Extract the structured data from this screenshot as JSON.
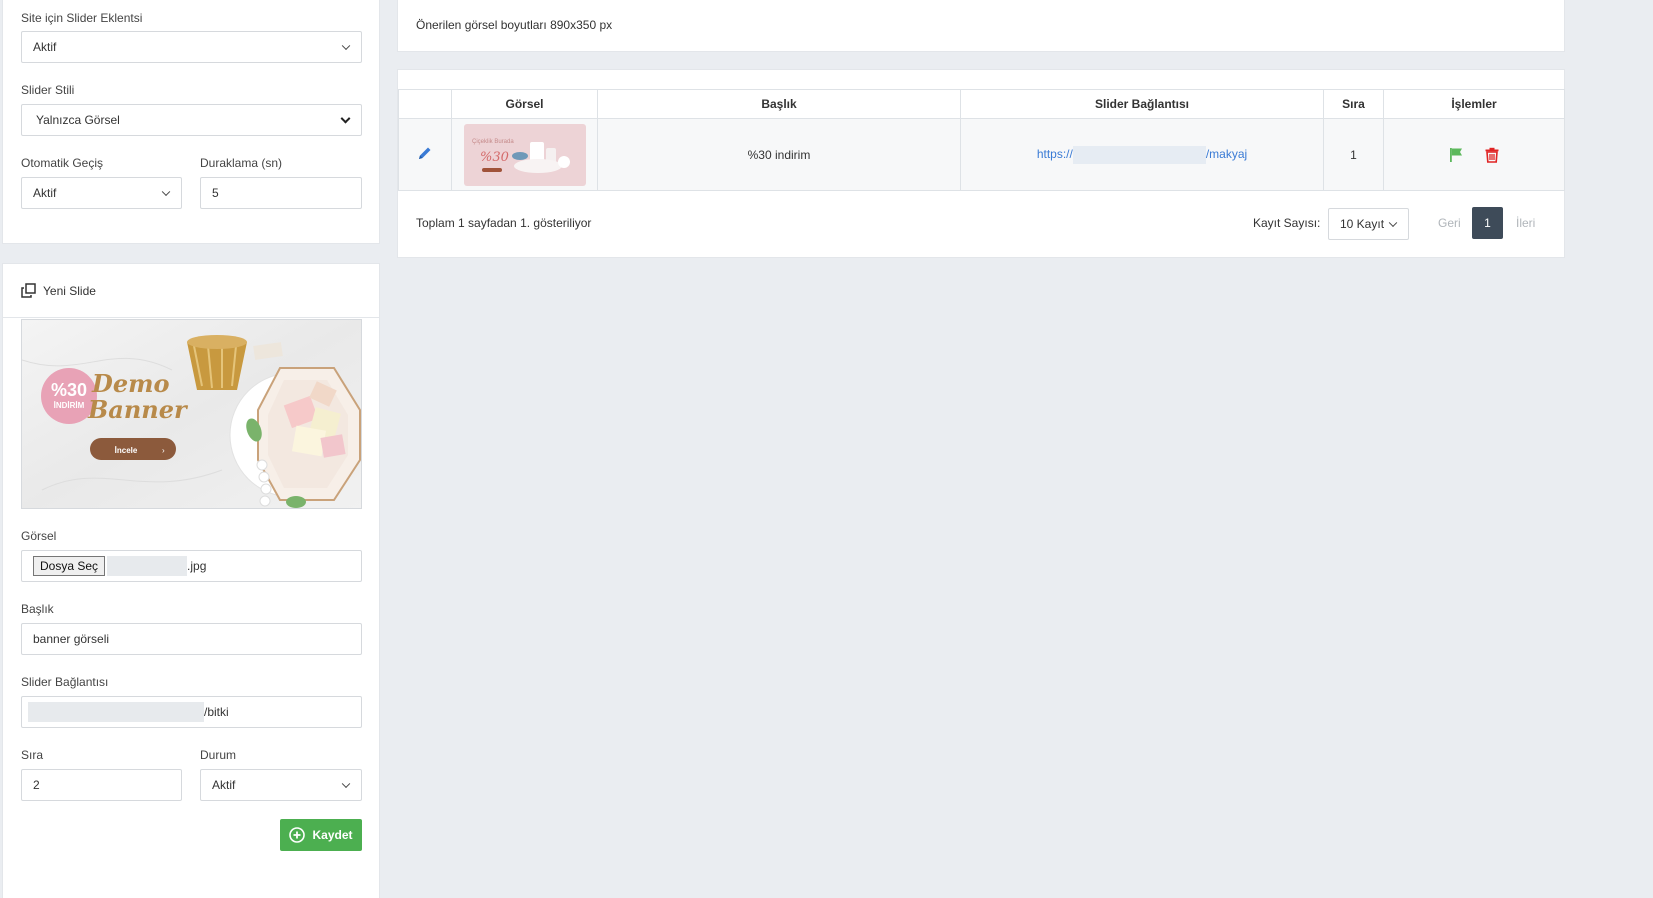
{
  "settings": {
    "plugin_label": "Site için Slider Eklentsi",
    "plugin_value": "Aktif",
    "style_label": "Slider Stili",
    "style_value": "Yalnızca Görsel",
    "auto_label": "Otomatik Geçiş",
    "auto_value": "Aktif",
    "pause_label": "Duraklama (sn)",
    "pause_value": "5"
  },
  "new_slide": {
    "title": "Yeni Slide",
    "preview": {
      "discount": "%30",
      "discount_sub": "İNDİRİM",
      "line1": "Demo",
      "line2": "Banner",
      "button": "İncele"
    },
    "image_label": "Görsel",
    "file_button": "Dosya Seç",
    "file_suffix": ".jpg",
    "title_label": "Başlık",
    "title_value": "banner görseli",
    "link_label": "Slider Bağlantısı",
    "link_suffix": "/bitki",
    "order_label": "Sıra",
    "order_value": "2",
    "status_label": "Durum",
    "status_value": "Aktif",
    "save_label": "Kaydet"
  },
  "info": {
    "text": "Önerilen görsel boyutları 890x350 px"
  },
  "table": {
    "headers": [
      "",
      "Görsel",
      "Başlık",
      "Slider Bağlantısı",
      "Sıra",
      "İşlemler"
    ],
    "rows": [
      {
        "thumb_text": "Çiçeklik Burada",
        "thumb_discount": "%30",
        "title": "%30 indirim",
        "link_prefix": "https://",
        "link_suffix": "/makyaj",
        "order": "1"
      }
    ],
    "footer": "Toplam 1 sayfadan 1. gösteriliyor",
    "page_size_label": "Kayıt Sayısı:",
    "page_size_value": "10 Kayıt",
    "prev": "Geri",
    "page": "1",
    "next": "İleri"
  },
  "colors": {
    "save": "#4caf50",
    "flag": "#5cb85c",
    "delete": "#e02424",
    "link": "#3a7bd5",
    "pager_active": "#3e4b59"
  }
}
